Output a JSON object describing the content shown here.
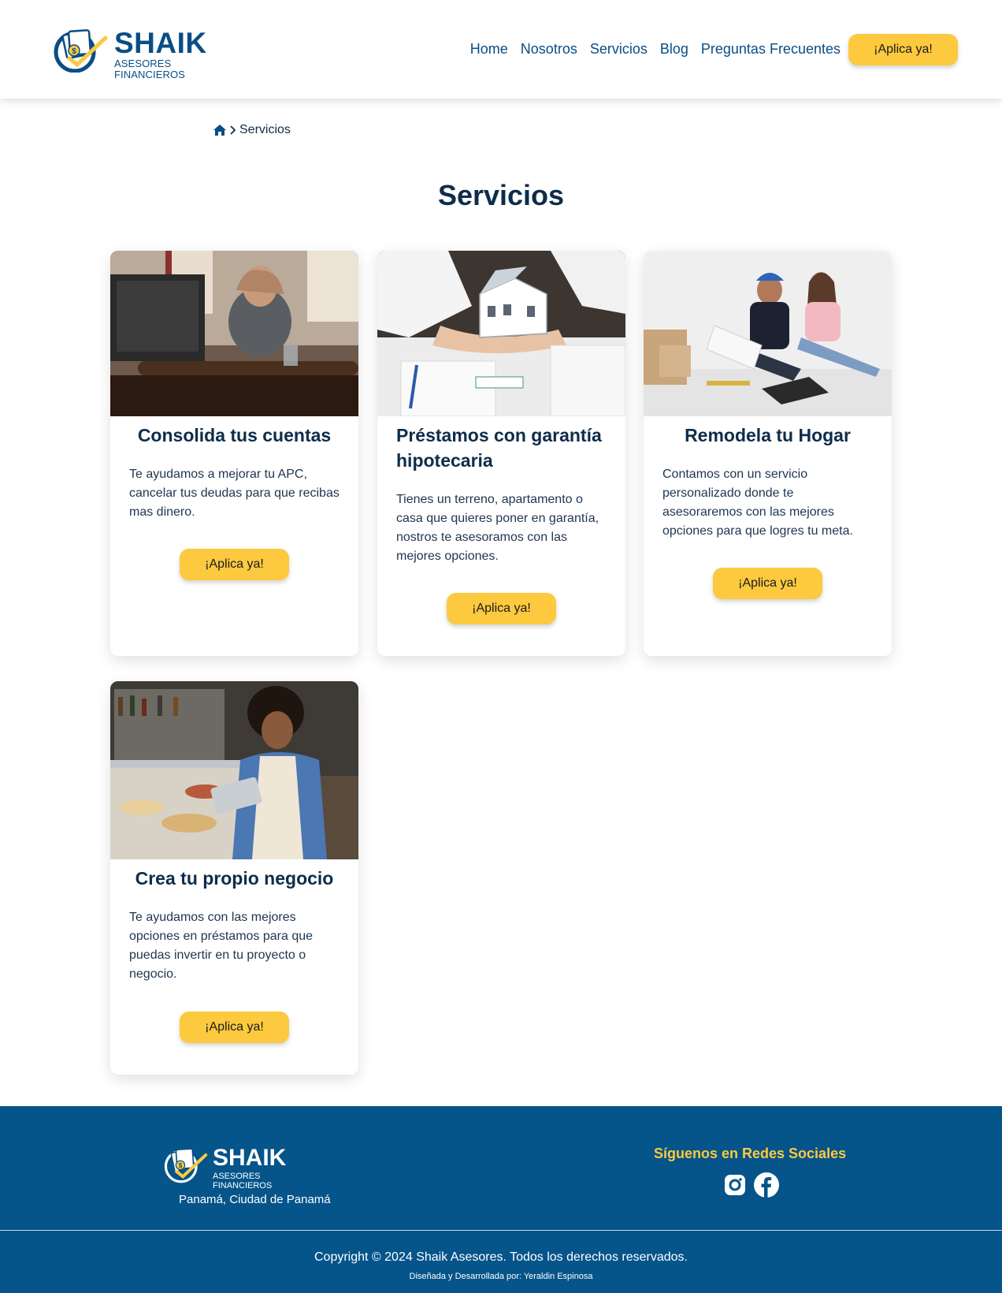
{
  "brand": {
    "name": "SHAIK",
    "tagline": "ASESORES FINANCIEROS",
    "primary_color": "#0a4d85",
    "accent_color": "#fcc93f"
  },
  "nav": {
    "items": [
      "Home",
      "Nosotros",
      "Servicios",
      "Blog",
      "Preguntas Frecuentes"
    ],
    "cta": "¡Aplica ya!"
  },
  "breadcrumb": {
    "home_icon": "home-icon",
    "separator_icon": "chevron-right-icon",
    "current": "Servicios"
  },
  "page": {
    "title": "Servicios"
  },
  "services": [
    {
      "title": "Consolida tus cuentas",
      "description": "Te ayudamos a mejorar tu APC, cancelar tus deudas para que recibas mas dinero.",
      "button": "¡Aplica ya!"
    },
    {
      "title": "Préstamos con garantía hipotecaria",
      "description": "Tienes un terreno, apartamento o casa que quieres poner en garantía, nostros te asesoramos con las mejores opciones.",
      "button": "¡Aplica ya!"
    },
    {
      "title": "Remodela tu Hogar",
      "description": "Contamos con un servicio personalizado donde te asesoraremos con las mejores opciones para que logres tu meta.",
      "button": "¡Aplica ya!"
    },
    {
      "title": "Crea tu propio negocio",
      "description": "Te ayudamos con las mejores opciones en préstamos para que puedas invertir en tu proyecto o negocio.",
      "button": "¡Aplica ya!"
    }
  ],
  "footer": {
    "brand": "SHAIK",
    "tagline": "ASESORES FINANCIEROS",
    "location": "Panamá, Ciudad de Panamá",
    "social_title": "Síguenos en Redes Sociales",
    "social_icons": [
      "instagram-icon",
      "facebook-icon"
    ],
    "copyright": "Copyright © 2024 Shaik Asesores. Todos los derechos reservados.",
    "credits": "Diseñada y Desarrollada por: Yeraldin Espinosa",
    "background_color": "#05548a"
  }
}
